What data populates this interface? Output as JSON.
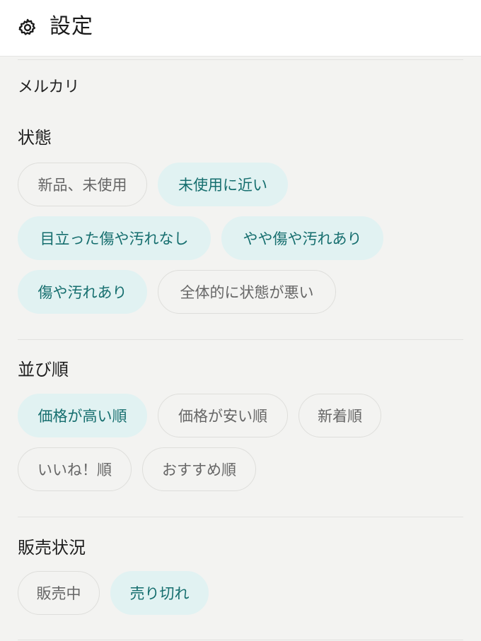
{
  "header": {
    "title": "設定",
    "icon": "gear-icon"
  },
  "service_label": "メルカリ",
  "sections": {
    "condition": {
      "title": "状態",
      "options": [
        {
          "label": "新品、未使用",
          "selected": false
        },
        {
          "label": "未使用に近い",
          "selected": true
        },
        {
          "label": "目立った傷や汚れなし",
          "selected": true
        },
        {
          "label": "やや傷や汚れあり",
          "selected": true
        },
        {
          "label": "傷や汚れあり",
          "selected": true
        },
        {
          "label": "全体的に状態が悪い",
          "selected": false
        }
      ]
    },
    "sort": {
      "title": "並び順",
      "options": [
        {
          "label": "価格が高い順",
          "selected": true
        },
        {
          "label": "価格が安い順",
          "selected": false
        },
        {
          "label": "新着順",
          "selected": false
        },
        {
          "label": "いいね！順",
          "selected": false
        },
        {
          "label": "おすすめ順",
          "selected": false
        }
      ]
    },
    "status": {
      "title": "販売状況",
      "options": [
        {
          "label": "販売中",
          "selected": false
        },
        {
          "label": "売り切れ",
          "selected": true
        }
      ]
    }
  },
  "colors": {
    "selected_bg": "#e1f2f2",
    "selected_text": "#156e6e",
    "unselected_border": "#dededb",
    "unselected_text": "#666666",
    "background": "#f3f3f1"
  }
}
